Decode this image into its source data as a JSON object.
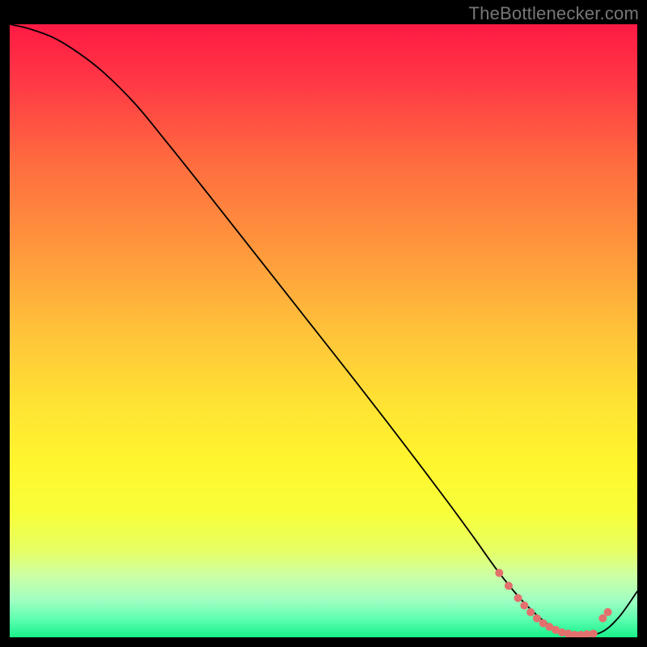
{
  "attribution": "TheBottlenecker.com",
  "chart_data": {
    "type": "line",
    "title": "",
    "xlabel": "",
    "ylabel": "",
    "xlim": [
      0,
      100
    ],
    "ylim": [
      0,
      100
    ],
    "background_gradient_stops": [
      {
        "offset": 0.0,
        "color": "#ff1a44"
      },
      {
        "offset": 0.1,
        "color": "#ff3a45"
      },
      {
        "offset": 0.22,
        "color": "#ff6a3f"
      },
      {
        "offset": 0.35,
        "color": "#ff923d"
      },
      {
        "offset": 0.5,
        "color": "#ffc23a"
      },
      {
        "offset": 0.62,
        "color": "#ffe333"
      },
      {
        "offset": 0.72,
        "color": "#fff62e"
      },
      {
        "offset": 0.8,
        "color": "#f6ff3a"
      },
      {
        "offset": 0.86,
        "color": "#e6ff66"
      },
      {
        "offset": 0.9,
        "color": "#ccffa6"
      },
      {
        "offset": 0.94,
        "color": "#9fffc2"
      },
      {
        "offset": 0.97,
        "color": "#5fffb0"
      },
      {
        "offset": 1.0,
        "color": "#17f08a"
      }
    ],
    "series": [
      {
        "name": "bottleneck-curve",
        "color": "#000000",
        "width": 1.8,
        "x": [
          0,
          3,
          7,
          11,
          15,
          20,
          25,
          30,
          35,
          40,
          45,
          50,
          55,
          60,
          65,
          70,
          74,
          78,
          82,
          86,
          90,
          94,
          97,
          100
        ],
        "y": [
          100,
          99.3,
          97.8,
          95.3,
          92.1,
          87.0,
          80.8,
          74.4,
          67.9,
          61.4,
          54.9,
          48.4,
          41.9,
          35.3,
          28.6,
          21.8,
          16.2,
          10.5,
          5.6,
          2.0,
          0.4,
          0.7,
          3.2,
          7.5
        ]
      }
    ],
    "markers": {
      "name": "highlight-dots",
      "color": "#e4706d",
      "radius": 5,
      "points": [
        {
          "x": 78.0,
          "y": 10.5
        },
        {
          "x": 79.5,
          "y": 8.4
        },
        {
          "x": 81.0,
          "y": 6.4
        },
        {
          "x": 82.0,
          "y": 5.2
        },
        {
          "x": 83.0,
          "y": 4.1
        },
        {
          "x": 84.0,
          "y": 3.1
        },
        {
          "x": 85.0,
          "y": 2.3
        },
        {
          "x": 86.0,
          "y": 1.7
        },
        {
          "x": 87.0,
          "y": 1.2
        },
        {
          "x": 88.0,
          "y": 0.8
        },
        {
          "x": 89.0,
          "y": 0.6
        },
        {
          "x": 90.0,
          "y": 0.4
        },
        {
          "x": 91.0,
          "y": 0.4
        },
        {
          "x": 92.0,
          "y": 0.5
        },
        {
          "x": 93.0,
          "y": 0.6
        },
        {
          "x": 94.5,
          "y": 3.1
        },
        {
          "x": 95.3,
          "y": 4.1
        }
      ]
    }
  }
}
